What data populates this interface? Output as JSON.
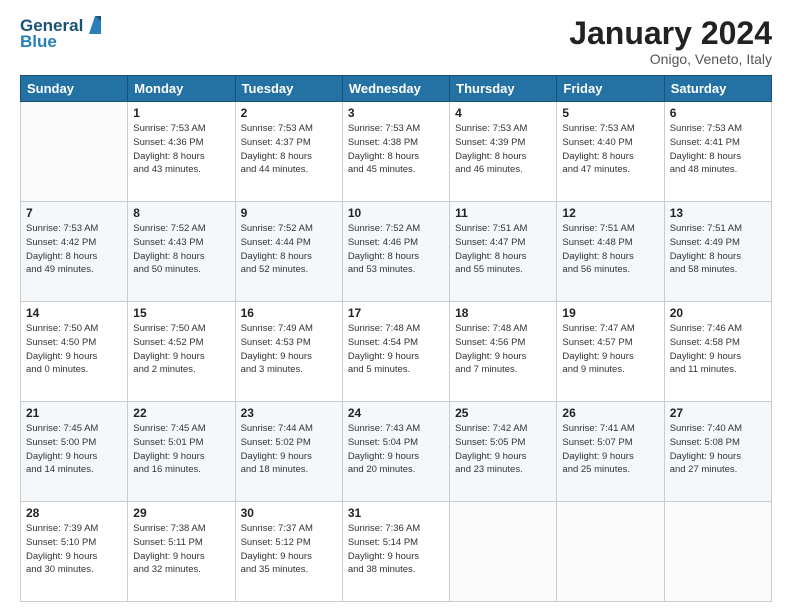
{
  "logo": {
    "line1": "General",
    "line2": "Blue"
  },
  "header": {
    "month": "January 2024",
    "location": "Onigo, Veneto, Italy"
  },
  "weekdays": [
    "Sunday",
    "Monday",
    "Tuesday",
    "Wednesday",
    "Thursday",
    "Friday",
    "Saturday"
  ],
  "weeks": [
    [
      {
        "day": "",
        "info": ""
      },
      {
        "day": "1",
        "info": "Sunrise: 7:53 AM\nSunset: 4:36 PM\nDaylight: 8 hours\nand 43 minutes."
      },
      {
        "day": "2",
        "info": "Sunrise: 7:53 AM\nSunset: 4:37 PM\nDaylight: 8 hours\nand 44 minutes."
      },
      {
        "day": "3",
        "info": "Sunrise: 7:53 AM\nSunset: 4:38 PM\nDaylight: 8 hours\nand 45 minutes."
      },
      {
        "day": "4",
        "info": "Sunrise: 7:53 AM\nSunset: 4:39 PM\nDaylight: 8 hours\nand 46 minutes."
      },
      {
        "day": "5",
        "info": "Sunrise: 7:53 AM\nSunset: 4:40 PM\nDaylight: 8 hours\nand 47 minutes."
      },
      {
        "day": "6",
        "info": "Sunrise: 7:53 AM\nSunset: 4:41 PM\nDaylight: 8 hours\nand 48 minutes."
      }
    ],
    [
      {
        "day": "7",
        "info": "Sunrise: 7:53 AM\nSunset: 4:42 PM\nDaylight: 8 hours\nand 49 minutes."
      },
      {
        "day": "8",
        "info": "Sunrise: 7:52 AM\nSunset: 4:43 PM\nDaylight: 8 hours\nand 50 minutes."
      },
      {
        "day": "9",
        "info": "Sunrise: 7:52 AM\nSunset: 4:44 PM\nDaylight: 8 hours\nand 52 minutes."
      },
      {
        "day": "10",
        "info": "Sunrise: 7:52 AM\nSunset: 4:46 PM\nDaylight: 8 hours\nand 53 minutes."
      },
      {
        "day": "11",
        "info": "Sunrise: 7:51 AM\nSunset: 4:47 PM\nDaylight: 8 hours\nand 55 minutes."
      },
      {
        "day": "12",
        "info": "Sunrise: 7:51 AM\nSunset: 4:48 PM\nDaylight: 8 hours\nand 56 minutes."
      },
      {
        "day": "13",
        "info": "Sunrise: 7:51 AM\nSunset: 4:49 PM\nDaylight: 8 hours\nand 58 minutes."
      }
    ],
    [
      {
        "day": "14",
        "info": "Sunrise: 7:50 AM\nSunset: 4:50 PM\nDaylight: 9 hours\nand 0 minutes."
      },
      {
        "day": "15",
        "info": "Sunrise: 7:50 AM\nSunset: 4:52 PM\nDaylight: 9 hours\nand 2 minutes."
      },
      {
        "day": "16",
        "info": "Sunrise: 7:49 AM\nSunset: 4:53 PM\nDaylight: 9 hours\nand 3 minutes."
      },
      {
        "day": "17",
        "info": "Sunrise: 7:48 AM\nSunset: 4:54 PM\nDaylight: 9 hours\nand 5 minutes."
      },
      {
        "day": "18",
        "info": "Sunrise: 7:48 AM\nSunset: 4:56 PM\nDaylight: 9 hours\nand 7 minutes."
      },
      {
        "day": "19",
        "info": "Sunrise: 7:47 AM\nSunset: 4:57 PM\nDaylight: 9 hours\nand 9 minutes."
      },
      {
        "day": "20",
        "info": "Sunrise: 7:46 AM\nSunset: 4:58 PM\nDaylight: 9 hours\nand 11 minutes."
      }
    ],
    [
      {
        "day": "21",
        "info": "Sunrise: 7:45 AM\nSunset: 5:00 PM\nDaylight: 9 hours\nand 14 minutes."
      },
      {
        "day": "22",
        "info": "Sunrise: 7:45 AM\nSunset: 5:01 PM\nDaylight: 9 hours\nand 16 minutes."
      },
      {
        "day": "23",
        "info": "Sunrise: 7:44 AM\nSunset: 5:02 PM\nDaylight: 9 hours\nand 18 minutes."
      },
      {
        "day": "24",
        "info": "Sunrise: 7:43 AM\nSunset: 5:04 PM\nDaylight: 9 hours\nand 20 minutes."
      },
      {
        "day": "25",
        "info": "Sunrise: 7:42 AM\nSunset: 5:05 PM\nDaylight: 9 hours\nand 23 minutes."
      },
      {
        "day": "26",
        "info": "Sunrise: 7:41 AM\nSunset: 5:07 PM\nDaylight: 9 hours\nand 25 minutes."
      },
      {
        "day": "27",
        "info": "Sunrise: 7:40 AM\nSunset: 5:08 PM\nDaylight: 9 hours\nand 27 minutes."
      }
    ],
    [
      {
        "day": "28",
        "info": "Sunrise: 7:39 AM\nSunset: 5:10 PM\nDaylight: 9 hours\nand 30 minutes."
      },
      {
        "day": "29",
        "info": "Sunrise: 7:38 AM\nSunset: 5:11 PM\nDaylight: 9 hours\nand 32 minutes."
      },
      {
        "day": "30",
        "info": "Sunrise: 7:37 AM\nSunset: 5:12 PM\nDaylight: 9 hours\nand 35 minutes."
      },
      {
        "day": "31",
        "info": "Sunrise: 7:36 AM\nSunset: 5:14 PM\nDaylight: 9 hours\nand 38 minutes."
      },
      {
        "day": "",
        "info": ""
      },
      {
        "day": "",
        "info": ""
      },
      {
        "day": "",
        "info": ""
      }
    ]
  ]
}
